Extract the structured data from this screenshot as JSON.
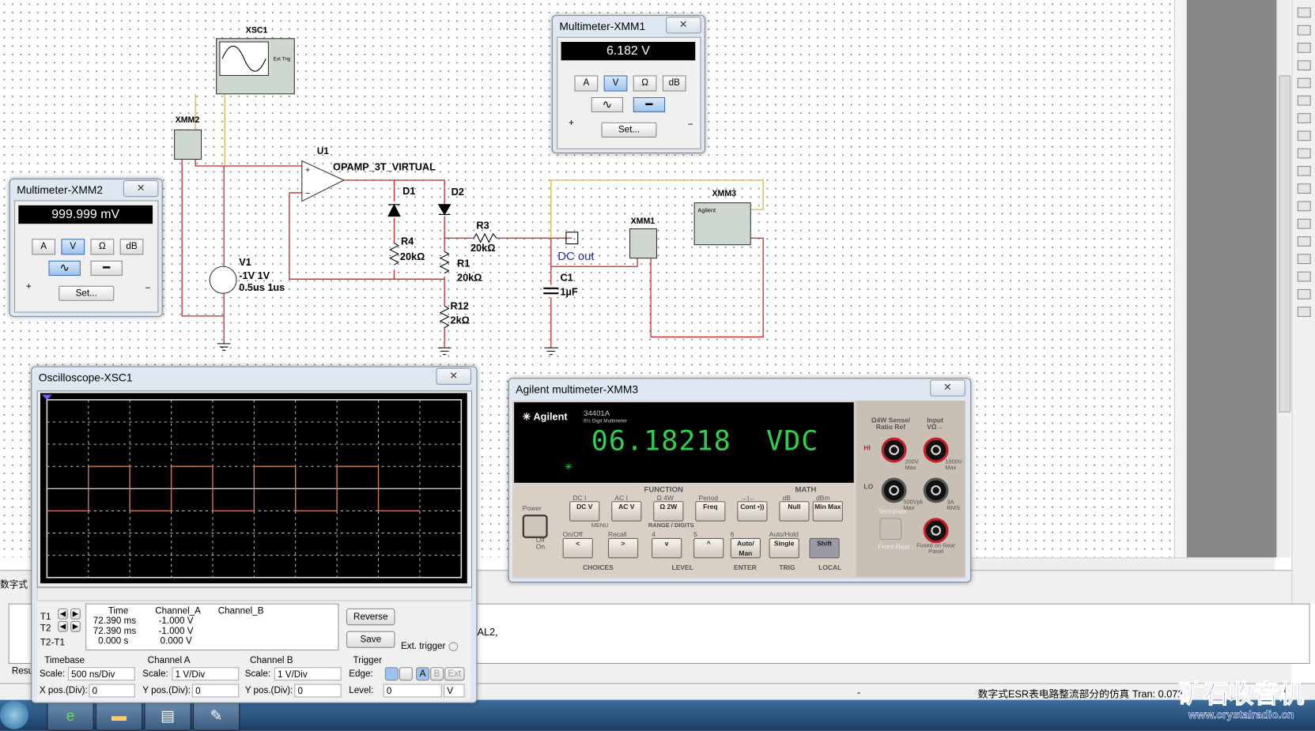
{
  "schematic": {
    "xsc1_label": "XSC1",
    "xsc1_ext_trig": "Ext Trig",
    "xmm2_label": "XMM2",
    "xmm1_label": "XMM1",
    "xmm3_label": "XMM3",
    "xmm3_brand": "Agilent",
    "u1_label": "U1",
    "u1_model": "OPAMP_3T_VIRTUAL",
    "d1_label": "D1",
    "d2_label": "D2",
    "r3_label": "R3",
    "r3_value": "20kΩ",
    "r4_label": "R4",
    "r4_value": "20kΩ",
    "r1_label": "R1",
    "r1_value": "20kΩ",
    "r12_label": "R12",
    "r12_value": "2kΩ",
    "c1_label": "C1",
    "c1_value": "1µF",
    "v1_label": "V1",
    "v1_value1": "-1V 1V",
    "v1_value2": "0.5us 1us",
    "net_label": "DC out"
  },
  "multimeter_xmm1": {
    "title": "Multimeter-XMM1",
    "close": "✕",
    "reading": "6.182 V",
    "buttons": [
      "A",
      "V",
      "Ω",
      "dB"
    ],
    "active": "V",
    "mode": "DC",
    "set_label": "Set...",
    "plus": "+",
    "minus": "−"
  },
  "multimeter_xmm2": {
    "title": "Multimeter-XMM2",
    "close": "✕",
    "reading": "999.999 mV",
    "buttons": [
      "A",
      "V",
      "Ω",
      "dB"
    ],
    "active": "V",
    "mode": "AC",
    "set_label": "Set...",
    "plus": "+",
    "minus": "−"
  },
  "oscilloscope": {
    "title": "Oscilloscope-XSC1",
    "close": "✕",
    "cursor_headers": [
      "Time",
      "Channel_A",
      "Channel_B"
    ],
    "rows": [
      {
        "label": "T1",
        "time": "72.390 ms",
        "a": "-1.000 V",
        "b": ""
      },
      {
        "label": "T2",
        "time": "72.390 ms",
        "a": "-1.000 V",
        "b": ""
      },
      {
        "label": "T2-T1",
        "time": "0.000 s",
        "a": "0.000 V",
        "b": ""
      }
    ],
    "reverse_label": "Reverse",
    "save_label": "Save",
    "ext_trigger_label": "Ext. trigger",
    "timebase": {
      "title": "Timebase",
      "scale_label": "Scale:",
      "scale": "500 ns/Div",
      "pos_label": "X pos.(Div):",
      "pos": "0"
    },
    "channel_a": {
      "title": "Channel A",
      "scale_label": "Scale:",
      "scale": "1 V/Div",
      "pos_label": "Y pos.(Div):",
      "pos": "0"
    },
    "channel_b": {
      "title": "Channel B",
      "scale_label": "Scale:",
      "scale": "1 V/Div",
      "pos_label": "Y pos.(Div):",
      "pos": "0"
    },
    "trigger": {
      "title": "Trigger",
      "edge_label": "Edge:",
      "level_label": "Level:",
      "level": "0",
      "level_unit": "V",
      "sources": [
        "A",
        "B",
        "Ext"
      ]
    },
    "trace_color": "#c87a5a",
    "waveform_levels_v": [
      -1,
      1,
      -1,
      1,
      -1,
      1,
      -1,
      1,
      -1
    ]
  },
  "agilent": {
    "title": "Agilent multimeter-XMM3",
    "close": "✕",
    "brand": "Agilent",
    "model": "34401A",
    "model_sub": "6½ Digit Multimeter",
    "display": "06.18218  VDC",
    "display_color": "#2fd14a",
    "function_label": "FUNCTION",
    "math_label": "MATH",
    "range_label": "RANGE / DIGITS",
    "menu_label": "MENU",
    "power_label": "Power",
    "off_label": "Off",
    "on_label": "On",
    "top_buttons": [
      {
        "shift": "DC I",
        "label": "DC V"
      },
      {
        "shift": "AC I",
        "label": "AC V"
      },
      {
        "shift": "Ω 4W",
        "label": "Ω 2W"
      },
      {
        "shift": "Period",
        "label": "Freq"
      },
      {
        "shift": "→|←",
        "label": "Cont •))"
      },
      {
        "shift": "dB",
        "label": "Null"
      },
      {
        "shift": "dBm",
        "label": "Min Max"
      }
    ],
    "bottom_buttons": [
      {
        "shift": "On/Off",
        "label": "<"
      },
      {
        "shift": "Recall",
        "label": ">"
      },
      {
        "shift": "4",
        "label": "v"
      },
      {
        "shift": "5",
        "label": "^"
      },
      {
        "shift": "6",
        "label": "Auto/ Man"
      },
      {
        "shift": "Auto/Hold",
        "label": "Single"
      },
      {
        "shift": "",
        "label": "Shift"
      }
    ],
    "bottom_labels": [
      "CHOICES",
      "LEVEL",
      "ENTER",
      "TRIG",
      "LOCAL"
    ],
    "terminal_labels": {
      "sense": "Ω4W Sense/ Ratio Ref",
      "input": "Input VΩ→",
      "hi": "HI",
      "lo": "LO",
      "v200": "200V Max",
      "v1000": "1000V Max",
      "v500": "500Vpk Max",
      "a3": "3A RMS",
      "fused": "Fused on Rear Panel",
      "front_rear": "Front Rear",
      "terminals": "Terminals"
    }
  },
  "bottom": {
    "output_fragment": "AL2,",
    "tab_partial": "数字式",
    "res_partial": "Resu",
    "status_dash": "-",
    "status_text": "数字式ESR表电路整流部分的仿真 Tran: 0.072 s"
  },
  "watermark": {
    "title": "矿石收音机",
    "url": "www.crystalradio.cn"
  }
}
